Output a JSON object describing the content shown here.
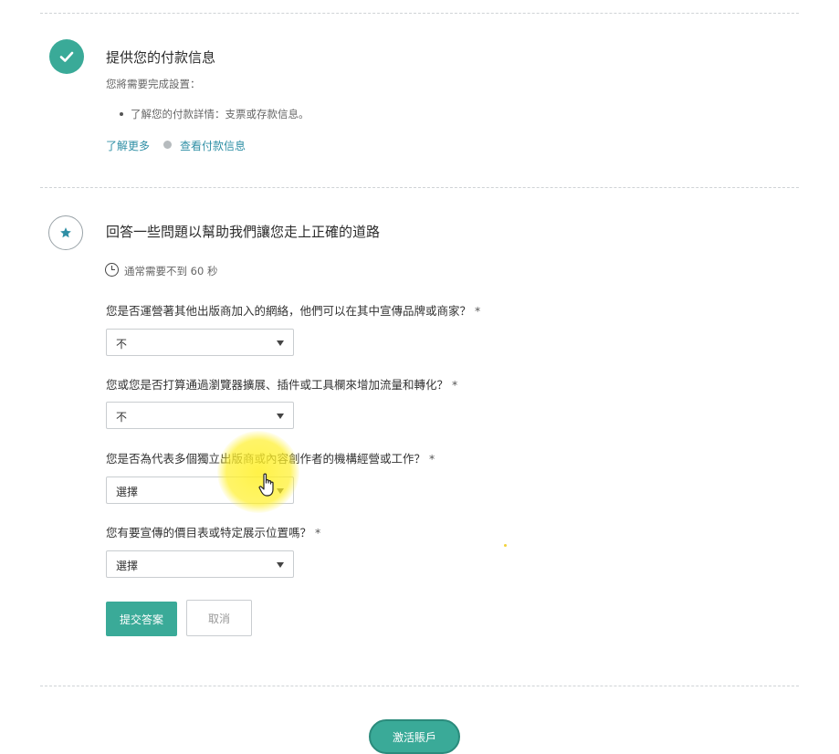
{
  "section1": {
    "title": "提供您的付款信息",
    "subtitle": "您將需要完成設置：",
    "bullet": "了解您的付款詳情：支票或存款信息。",
    "learn_more": "了解更多",
    "view_payment": "查看付款信息"
  },
  "section2": {
    "title": "回答一些問題以幫助我們讓您走上正確的道路",
    "time_note": "通常需要不到 60 秒",
    "questions": [
      {
        "label": "您是否運營著其他出版商加入的網絡，他們可以在其中宣傳品牌或商家？",
        "value": "不"
      },
      {
        "label": "您或您是否打算通過瀏覽器擴展、插件或工具欄來增加流量和轉化？",
        "value": "不"
      },
      {
        "label": "您是否為代表多個獨立出版商或內容創作者的機構經營或工作？",
        "value": "選擇"
      },
      {
        "label": "您有要宣傳的價目表或特定展示位置嗎？",
        "value": "選擇"
      }
    ],
    "required_mark": "*",
    "submit_label": "提交答案",
    "cancel_label": "取消"
  },
  "footer": {
    "activate_label": "激活賬戶"
  },
  "colors": {
    "accent": "#3aaa98",
    "link": "#2f8fa5"
  }
}
